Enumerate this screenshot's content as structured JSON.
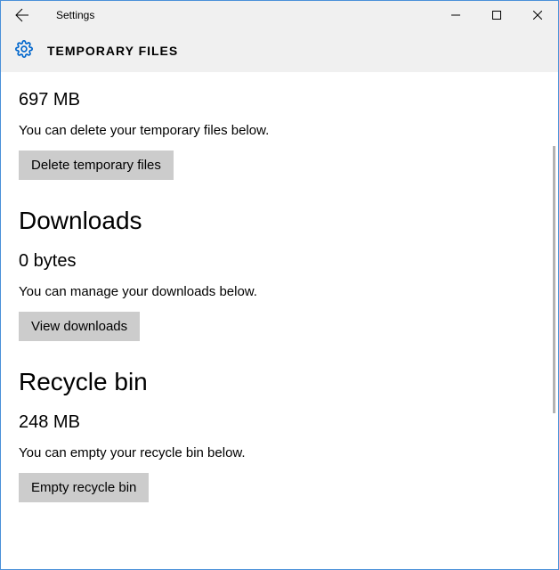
{
  "window": {
    "title": "Settings"
  },
  "header": {
    "heading": "TEMPORARY FILES"
  },
  "sections": {
    "temp": {
      "size": "697 MB",
      "desc": "You can delete your temporary files below.",
      "button": "Delete temporary files"
    },
    "downloads": {
      "heading": "Downloads",
      "size": "0 bytes",
      "desc": "You can manage your downloads below.",
      "button": "View downloads"
    },
    "recycle": {
      "heading": "Recycle bin",
      "size": "248 MB",
      "desc": "You can empty your recycle bin below.",
      "button": "Empty recycle bin"
    }
  }
}
